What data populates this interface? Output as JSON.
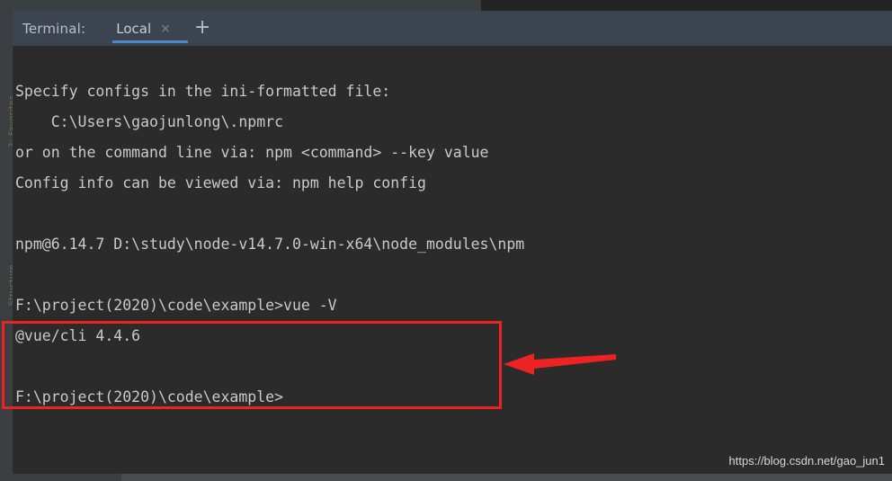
{
  "window": {
    "tool_window_title": "Terminal:",
    "gutter_label_top": "2: Favorites",
    "gutter_label_bottom": "Structure"
  },
  "tabs": {
    "items": [
      {
        "label": "Local",
        "close_icon": "×",
        "active": true
      }
    ],
    "add_tab_icon": "+"
  },
  "terminal": {
    "lines": [
      "",
      "Specify configs in the ini-formatted file:",
      "    C:\\Users\\gaojunlong\\.npmrc",
      "or on the command line via: npm <command> --key value",
      "Config info can be viewed via: npm help config",
      "",
      "npm@6.14.7 D:\\study\\node-v14.7.0-win-x64\\node_modules\\npm",
      "",
      "F:\\project(2020)\\code\\example>vue -V",
      "@vue/cli 4.4.6",
      "",
      "F:\\project(2020)\\code\\example>"
    ]
  },
  "annotations": {
    "highlight_box_color": "#ee2222",
    "arrow_color": "#ee2222",
    "arrow_direction": "left",
    "highlighted_lines": [
      "F:\\project(2020)\\code\\example>vue -V",
      "@vue/cli 4.4.6"
    ]
  },
  "watermark": {
    "text": "https://blog.csdn.net/gao_jun1"
  },
  "colors": {
    "console_bg": "#2b2b2b",
    "console_text": "#c9cbc8",
    "tab_bar_bg": "#3c4450",
    "tab_active_underline": "#4a88c7",
    "chrome_bg": "#3c3f41"
  }
}
